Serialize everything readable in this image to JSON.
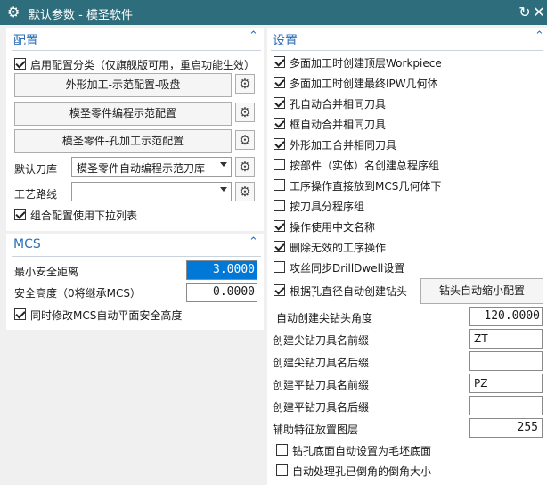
{
  "window": {
    "title": "默认参数 - 模圣软件",
    "icon": "gear-icon"
  },
  "left": {
    "config": {
      "title": "配置",
      "enable_checkbox": {
        "label": "启用配置分类（仅旗舰版可用，重启功能生效）",
        "checked": true
      },
      "buttons": [
        "外形加工-示范配置-吸盘",
        "模圣零件编程示范配置",
        "模圣零件-孔加工示范配置"
      ],
      "tool_library": {
        "label": "默认刀库",
        "value": "模圣零件自动编程示范刀库"
      },
      "process_route": {
        "label": "工艺路线",
        "value": ""
      },
      "combo_checkbox": {
        "label": "组合配置使用下拉列表",
        "checked": true
      }
    },
    "mcs": {
      "title": "MCS",
      "min_safe_distance": {
        "label": "最小安全距离",
        "value": "3.0000"
      },
      "safe_height": {
        "label": "安全高度（0将继承MCS）",
        "value": "0.0000"
      },
      "sync_checkbox": {
        "label": "同时修改MCS自动平面安全高度",
        "checked": true
      }
    }
  },
  "right": {
    "title": "设置",
    "checkboxes": [
      {
        "label": "多面加工时创建顶层Workpiece",
        "checked": true
      },
      {
        "label": "多面加工时创建最终IPW几何体",
        "checked": true
      },
      {
        "label": "孔自动合并相同刀具",
        "checked": true
      },
      {
        "label": "框自动合并相同刀具",
        "checked": true
      },
      {
        "label": "外形加工合并相同刀具",
        "checked": true
      },
      {
        "label": "按部件（实体）名创建总程序组",
        "checked": false
      },
      {
        "label": "工序操作直接放到MCS几何体下",
        "checked": false
      },
      {
        "label": "按刀具分程序组",
        "checked": false
      },
      {
        "label": "操作使用中文名称",
        "checked": true
      },
      {
        "label": "删除无效的工序操作",
        "checked": true
      },
      {
        "label": "攻丝同步DrillDwell设置",
        "checked": false
      },
      {
        "label": "根据孔直径自动创建钻头",
        "checked": true
      }
    ],
    "drill_shrink_button": "钻头自动缩小配置",
    "fields": [
      {
        "label": "自动创建尖钻头角度",
        "value": "120.0000",
        "kind": "num"
      },
      {
        "label": "创建尖钻刀具名前缀",
        "value": "ZT",
        "kind": "txt"
      },
      {
        "label": "创建尖钻刀具名后缀",
        "value": "",
        "kind": "txt"
      },
      {
        "label": "创建平钻刀具名前缀",
        "value": "PZ",
        "kind": "txt"
      },
      {
        "label": "创建平钻刀具名后缀",
        "value": "",
        "kind": "txt"
      },
      {
        "label": "辅助特征放置图层",
        "value": "255",
        "kind": "num"
      }
    ],
    "bottom_checkboxes": [
      {
        "label": "钻孔底面自动设置为毛坯底面",
        "checked": false
      },
      {
        "label": "自动处理孔已倒角的倒角大小",
        "checked": false
      }
    ]
  }
}
